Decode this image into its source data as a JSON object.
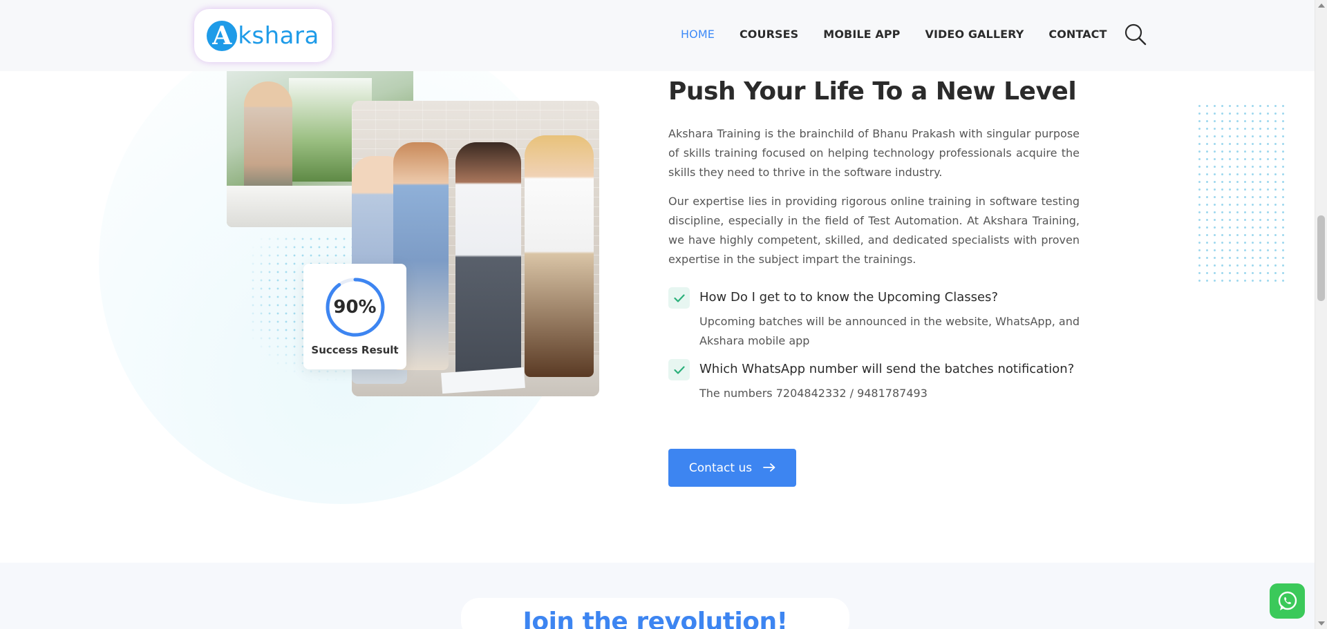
{
  "header": {
    "logo_letter": "A",
    "logo_text": "kshara",
    "nav": [
      "HOME",
      "COURSES",
      "MOBILE APP",
      "VIDEO GALLERY",
      "CONTACT"
    ]
  },
  "stat": {
    "value": "90%",
    "progress": 0.9,
    "label": "Success Result"
  },
  "about": {
    "title": "Push Your Life To a New Level",
    "paragraphs": [
      "Akshara Training is the brainchild of Bhanu Prakash with singular purpose of skills training focused on helping technology professionals acquire the skills they need to thrive in the software industry.",
      "Our expertise lies in providing rigorous online training in  software testing discipline, especially in the field of Test Automation. At Akshara Training, we have highly competent, skilled, and dedicated specialists with proven expertise in the subject impart the trainings."
    ],
    "faqs": [
      {
        "q": "How Do I get to to know the Upcoming Classes?",
        "a": "Upcoming batches will be announced in the website, WhatsApp, and Akshara mobile app"
      },
      {
        "q": "Which WhatsApp number will send the batches notification?",
        "a": "The numbers 7204842332 / 9481787493"
      }
    ],
    "cta_label": "Contact us"
  },
  "next_section": {
    "title": "Join the revolution!"
  },
  "icons": {
    "search": "search-icon",
    "check": "check-icon",
    "arrow": "arrow-right-icon",
    "whatsapp": "whatsapp-icon"
  },
  "colors": {
    "accent": "#3d85f1",
    "brand": "#1e9be8",
    "check_bg": "#e7f6f1",
    "check": "#2ab07a",
    "whatsapp": "#3bc95a"
  }
}
